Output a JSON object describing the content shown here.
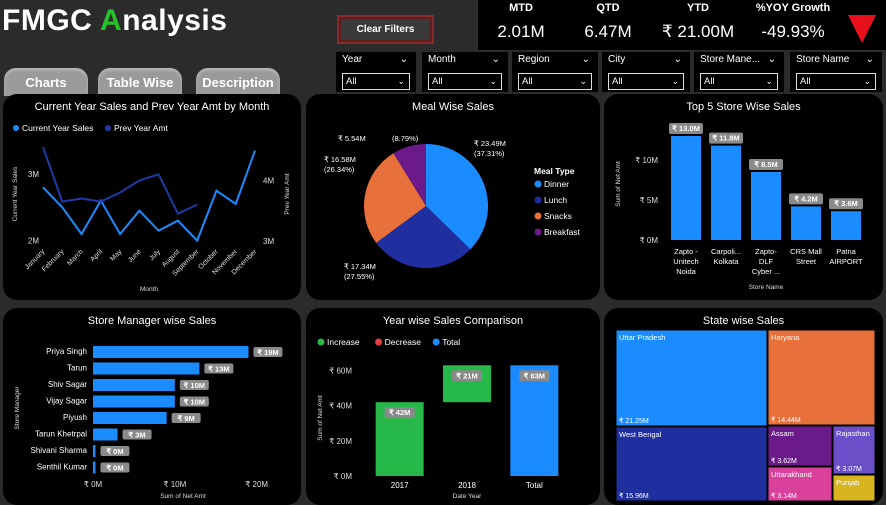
{
  "header": {
    "title_prefix": "FMGC ",
    "title_accent": "A",
    "title_rest": "nalysis",
    "clear_filters_label": "Clear Filters"
  },
  "kpis": [
    {
      "label": "MTD",
      "value": "2.01M"
    },
    {
      "label": "QTD",
      "value": "6.47M"
    },
    {
      "label": "YTD",
      "value": "₹ 21.00M"
    },
    {
      "label": "%YOY Growth",
      "value": "-49.93%"
    }
  ],
  "kpi_indicator": {
    "icon": "down-triangle-icon",
    "color": "#e8101a"
  },
  "tabs": [
    "Charts",
    "Table Wise",
    "Description"
  ],
  "slicers": [
    {
      "label": "Year",
      "value": "All"
    },
    {
      "label": "Month",
      "value": "All"
    },
    {
      "label": "Region",
      "value": "All"
    },
    {
      "label": "City",
      "value": "All"
    },
    {
      "label": "Store Mane...",
      "value": "All"
    },
    {
      "label": "Store Name",
      "value": "All"
    }
  ],
  "colors": {
    "accent_green": "#27c12a",
    "bar_blue": "#1a8cff",
    "panel_bg": "#000000",
    "page_bg": "#2b2b2b"
  },
  "chart_data": [
    {
      "type": "line",
      "title": "Current Year Sales and Prev Year Amt by Month",
      "xlabel": "Month",
      "ylabel": "Current Year Sales",
      "y2label": "Prev Year Amt",
      "legend": [
        "Current Year Sales",
        "Prev Year Amt"
      ],
      "categories": [
        "January",
        "February",
        "March",
        "April",
        "May",
        "June",
        "July",
        "August",
        "September",
        "October",
        "November",
        "December"
      ],
      "y_ticks": [
        "2M",
        "3M"
      ],
      "y2_ticks": [
        "3M",
        "4M"
      ],
      "ylim": [
        1.95,
        3.45
      ],
      "y2lim": [
        2.95,
        4.6
      ],
      "series": [
        {
          "name": "Current Year Sales",
          "color": "#1a8cff",
          "values": [
            2.8,
            2.5,
            2.1,
            2.6,
            2.1,
            2.45,
            2.15,
            2.3,
            2.0,
            2.75,
            2.55,
            3.35
          ]
        },
        {
          "name": "Prev Year Amt",
          "color": "#1f3aa8",
          "values": [
            4.55,
            3.65,
            3.7,
            3.65,
            3.8,
            4.0,
            4.1,
            3.45,
            3.6,
            null,
            null,
            null
          ]
        }
      ]
    },
    {
      "type": "pie",
      "title": "Meal Wise Sales",
      "legend_title": "Meal Type",
      "slices": [
        {
          "name": "Dinner",
          "value": 23.49,
          "label": "₹ 23.49M",
          "pct": "(37.31%)",
          "color": "#1a8cff"
        },
        {
          "name": "Lunch",
          "value": 17.34,
          "label": "₹ 17.34M",
          "pct": "(27.55%)",
          "color": "#1f2fa0"
        },
        {
          "name": "Snacks",
          "value": 16.58,
          "label": "₹ 16.58M",
          "pct": "(26.34%)",
          "color": "#e8703a"
        },
        {
          "name": "Breakfast",
          "value": 5.54,
          "label": "₹ 5.54M",
          "pct": "(8.79%)",
          "color": "#6b1a8a"
        }
      ]
    },
    {
      "type": "bar",
      "title": "Top 5 Store Wise Sales",
      "xlabel": "Store Name",
      "ylabel": "Sum of Net Amt",
      "y_ticks": [
        "₹ 0M",
        "₹ 5M",
        "₹ 10M"
      ],
      "ylim": [
        0,
        14.5
      ],
      "categories": [
        [
          "Zapto -",
          "Unitech",
          "Noida"
        ],
        [
          "Carpoli...",
          "Kolkata"
        ],
        [
          "Zapto-",
          "DLF",
          "Cyber ..."
        ],
        [
          "CRS Mall",
          "Street"
        ],
        [
          "Patna",
          "AIRPORT"
        ]
      ],
      "values": [
        13.0,
        11.8,
        8.5,
        4.2,
        3.6
      ],
      "labels": [
        "₹ 13.0M",
        "₹ 11.8M",
        "₹ 8.5M",
        "₹ 4.2M",
        "₹ 3.6M"
      ]
    },
    {
      "type": "bar",
      "orientation": "horizontal",
      "title": "Store Manager wise Sales",
      "xlabel": "Sum of Net Amt",
      "ylabel": "Store Manager",
      "x_ticks": [
        "₹ 0M",
        "₹ 10M",
        "₹ 20M"
      ],
      "xlim": [
        0,
        22
      ],
      "categories": [
        "Priya Singh",
        "Tarun",
        "Shiv Sagar",
        "Vijay Sagar",
        "Piyush",
        "Tarun Khetrpal",
        "Shivani Sharma",
        "Senthil Kumar"
      ],
      "values": [
        19,
        13,
        10,
        10,
        9,
        3,
        0.3,
        0.3
      ],
      "labels": [
        "₹ 19M",
        "₹ 13M",
        "₹ 10M",
        "₹ 10M",
        "₹ 9M",
        "₹ 3M",
        "₹ 0M",
        "₹ 0M"
      ]
    },
    {
      "type": "bar",
      "subtype": "waterfall",
      "title": "Year wise Sales Comparison",
      "xlabel": "Date Year",
      "ylabel": "Sum of Net Amt",
      "legend": [
        {
          "name": "Increase",
          "color": "#27b84a"
        },
        {
          "name": "Decrease",
          "color": "#e84040"
        },
        {
          "name": "Total",
          "color": "#1a8cff"
        }
      ],
      "y_ticks": [
        "₹ 0M",
        "₹ 20M",
        "₹ 40M",
        "₹ 60M"
      ],
      "ylim": [
        0,
        66
      ],
      "categories": [
        "2017",
        "2018",
        "Total"
      ],
      "bars": [
        {
          "start": 0,
          "end": 42,
          "label": "₹ 42M",
          "kind": "increase"
        },
        {
          "start": 42,
          "end": 63,
          "label": "₹ 21M",
          "kind": "increase"
        },
        {
          "start": 0,
          "end": 63,
          "label": "₹ 63M",
          "kind": "total"
        }
      ]
    },
    {
      "type": "heatmap",
      "subtype": "treemap",
      "title": "State wise Sales",
      "cells": [
        {
          "name": "Uttar Pradesh",
          "value": "₹ 21.25M",
          "color": "#1a8cff"
        },
        {
          "name": "West Bengal",
          "value": "₹ 15.96M",
          "color": "#1f2fa0"
        },
        {
          "name": "Haryana",
          "value": "₹ 14.44M",
          "color": "#e8703a"
        },
        {
          "name": "Assam",
          "value": "₹ 3.62M",
          "color": "#6b1a8a"
        },
        {
          "name": "Rajasthan",
          "value": "₹ 3.07M",
          "color": "#6a4fc8"
        },
        {
          "name": "Uttarakhand",
          "value": "₹ 3.14M",
          "color": "#d9409a"
        },
        {
          "name": "Punjab",
          "value": "",
          "color": "#d8b420"
        }
      ]
    }
  ]
}
